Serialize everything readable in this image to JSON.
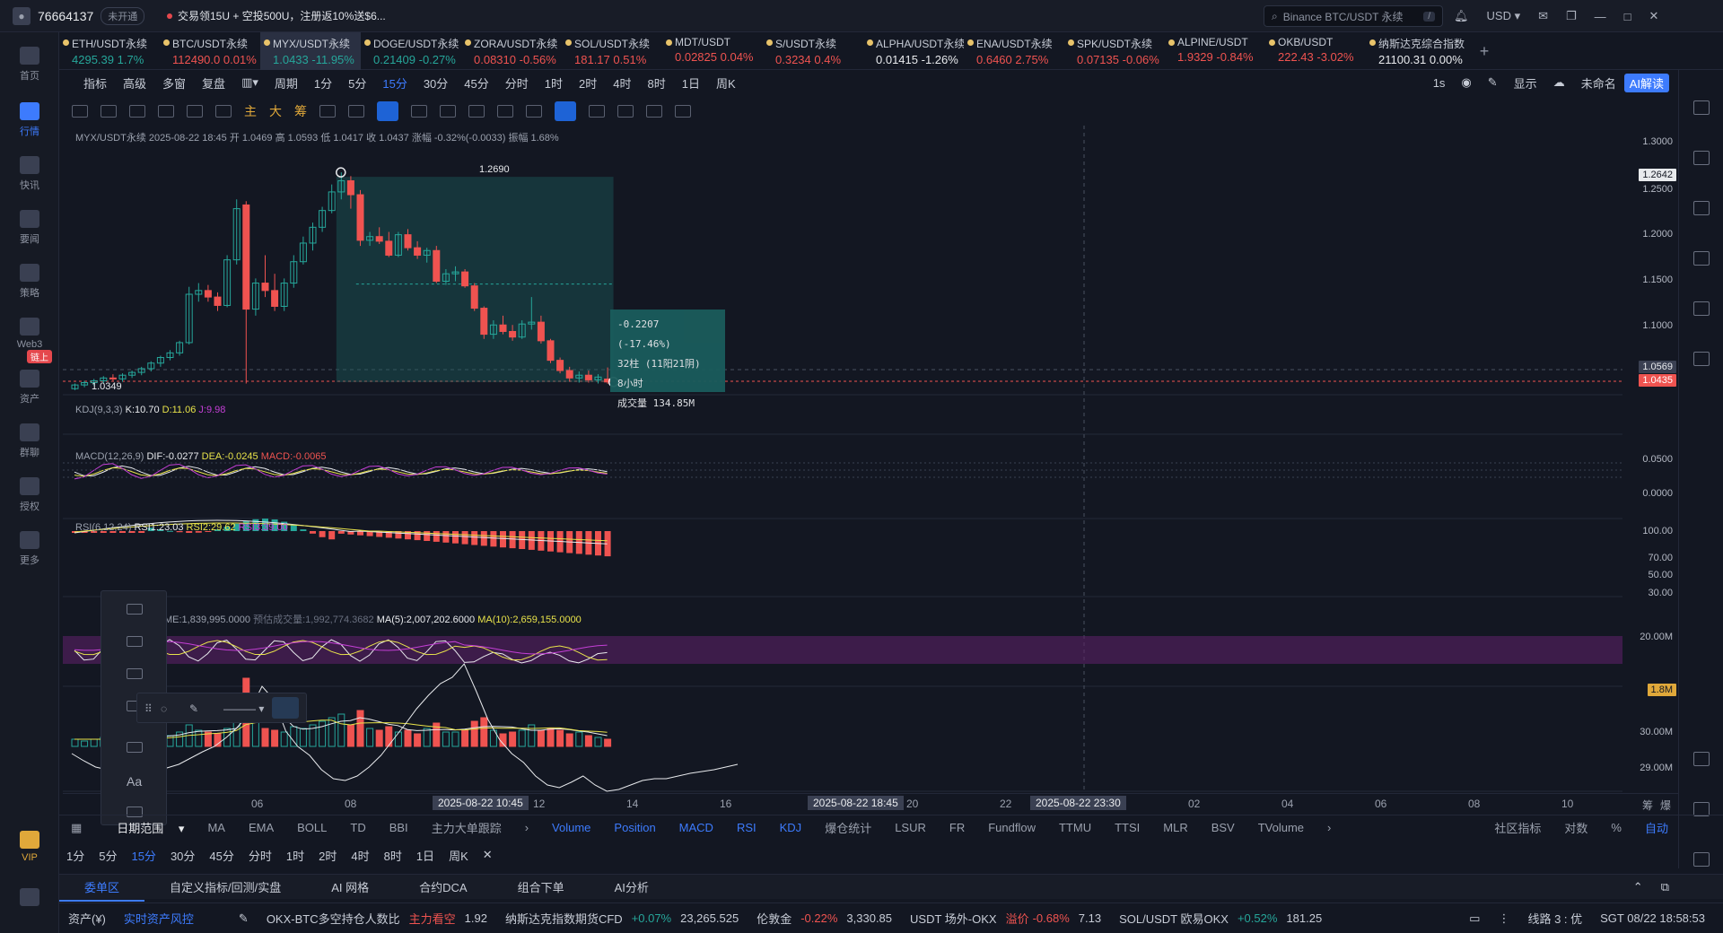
{
  "topbar": {
    "user_id": "76664137",
    "badge": "未开通",
    "promo": "交易领15U + 空投500U，注册返10%送$6...",
    "search_placeholder": "Binance BTC/USDT 永续",
    "search_kbd": "/",
    "currency": "USD"
  },
  "sidebar": {
    "items": [
      {
        "label": "首页"
      },
      {
        "label": "行情"
      },
      {
        "label": "快讯"
      },
      {
        "label": "要闻"
      },
      {
        "label": "策略"
      },
      {
        "label": "Web3"
      },
      {
        "label": "资产"
      },
      {
        "label": "群聊"
      },
      {
        "label": "授权"
      },
      {
        "label": "更多"
      },
      {
        "label": "VIP"
      }
    ],
    "badge_chain": "链上"
  },
  "tickers": [
    {
      "name": "ETH/USDT永续",
      "price": "4295.39",
      "change": "1.7%",
      "dir": "up"
    },
    {
      "name": "BTC/USDT永续",
      "price": "112490.0",
      "change": "0.01%",
      "dir": "dn"
    },
    {
      "name": "MYX/USDT永续",
      "price": "1.0433",
      "change": "-11.95%",
      "dir": "up"
    },
    {
      "name": "DOGE/USDT永续",
      "price": "0.21409",
      "change": "-0.27%",
      "dir": "up"
    },
    {
      "name": "ZORA/USDT永续",
      "price": "0.08310",
      "change": "-0.56%",
      "dir": "dn"
    },
    {
      "name": "SOL/USDT永续",
      "price": "181.17",
      "change": "0.51%",
      "dir": "dn"
    },
    {
      "name": "MDT/USDT",
      "price": "0.02825",
      "change": "0.04%",
      "dir": "dn"
    },
    {
      "name": "S/USDT永续",
      "price": "0.3234",
      "change": "0.4%",
      "dir": "dn"
    },
    {
      "name": "ALPHA/USDT永续",
      "price": "0.01415",
      "change": "-1.26%",
      "dir": "wh"
    },
    {
      "name": "ENA/USDT永续",
      "price": "0.6460",
      "change": "2.75%",
      "dir": "dn"
    },
    {
      "name": "SPK/USDT永续",
      "price": "0.07135",
      "change": "-0.06%",
      "dir": "dn"
    },
    {
      "name": "ALPINE/USDT",
      "price": "1.9329",
      "change": "-0.84%",
      "dir": "dn"
    },
    {
      "name": "OKB/USDT",
      "price": "222.43",
      "change": "-3.02%",
      "dir": "dn"
    },
    {
      "name": "纳斯达克综合指数",
      "price": "21100.31",
      "change": "0.00%",
      "dir": "wh"
    }
  ],
  "toolbar": {
    "items": [
      "指标",
      "高级",
      "多窗",
      "复盘",
      "周期",
      "1分",
      "5分",
      "15分",
      "30分",
      "45分",
      "分时",
      "1时",
      "2时",
      "4时",
      "8时",
      "1日",
      "周K"
    ],
    "selected": "15分",
    "right": [
      "1s",
      "显示",
      "未命名",
      "AI解读"
    ]
  },
  "drawbar": {
    "labels": [
      "主",
      "大",
      "筹"
    ]
  },
  "chart_data": {
    "type": "candlestick",
    "symbol": "MYX/USDT永续",
    "ohlc_line": "2025-08-22 18:45 开 1.0469 高 1.0593 低 1.0417 收 1.0437 涨幅 -0.32%(-0.0033) 振幅 1.68%",
    "y_ticks": [
      "1.3000",
      "1.2500",
      "1.2000",
      "1.1500",
      "1.1000"
    ],
    "price_tags": {
      "high_mark": "1.2642",
      "last_price": "1.0435",
      "crosshair": "1.0569"
    },
    "annotations": {
      "high": "1.2690",
      "low": "1.0349"
    },
    "measure": {
      "change": "-0.2207 (-17.46%)",
      "bars": "32柱 (11阳21阴)",
      "duration": "8小时",
      "volume": "成交量 134.85M"
    },
    "candles": [
      [
        1.0365,
        1.042,
        1.0349,
        1.0405
      ],
      [
        1.0405,
        1.045,
        1.038,
        1.043
      ],
      [
        1.043,
        1.047,
        1.04,
        1.045
      ],
      [
        1.045,
        1.05,
        1.042,
        1.048
      ],
      [
        1.048,
        1.052,
        1.045,
        1.047
      ],
      [
        1.047,
        1.053,
        1.044,
        1.051
      ],
      [
        1.051,
        1.056,
        1.048,
        1.054
      ],
      [
        1.054,
        1.06,
        1.051,
        1.058
      ],
      [
        1.058,
        1.066,
        1.055,
        1.064
      ],
      [
        1.064,
        1.072,
        1.06,
        1.07
      ],
      [
        1.07,
        1.078,
        1.067,
        1.075
      ],
      [
        1.075,
        1.088,
        1.072,
        1.086
      ],
      [
        1.086,
        1.146,
        1.084,
        1.138
      ],
      [
        1.138,
        1.15,
        1.13,
        1.142
      ],
      [
        1.142,
        1.148,
        1.13,
        1.135
      ],
      [
        1.135,
        1.14,
        1.12,
        1.126
      ],
      [
        1.126,
        1.18,
        1.124,
        1.175
      ],
      [
        1.175,
        1.24,
        1.17,
        1.23
      ],
      [
        1.234,
        1.238,
        1.042,
        1.122
      ],
      [
        1.122,
        1.155,
        1.115,
        1.15
      ],
      [
        1.15,
        1.18,
        1.135,
        1.142
      ],
      [
        1.142,
        1.16,
        1.12,
        1.125
      ],
      [
        1.125,
        1.155,
        1.12,
        1.15
      ],
      [
        1.15,
        1.18,
        1.145,
        1.173
      ],
      [
        1.173,
        1.2,
        1.17,
        1.193
      ],
      [
        1.193,
        1.215,
        1.185,
        1.21
      ],
      [
        1.21,
        1.232,
        1.205,
        1.228
      ],
      [
        1.228,
        1.256,
        1.225,
        1.248
      ],
      [
        1.248,
        1.269,
        1.24,
        1.26
      ],
      [
        1.26,
        1.265,
        1.23,
        1.245
      ],
      [
        1.245,
        1.25,
        1.19,
        1.196
      ],
      [
        1.196,
        1.205,
        1.19,
        1.2
      ],
      [
        1.2,
        1.21,
        1.192,
        1.195
      ],
      [
        1.195,
        1.205,
        1.178,
        1.18
      ],
      [
        1.18,
        1.205,
        1.178,
        1.202
      ],
      [
        1.202,
        1.208,
        1.185,
        1.188
      ],
      [
        1.188,
        1.195,
        1.176,
        1.18
      ],
      [
        1.18,
        1.188,
        1.172,
        1.185
      ],
      [
        1.185,
        1.19,
        1.15,
        1.152
      ],
      [
        1.152,
        1.165,
        1.148,
        1.16
      ],
      [
        1.16,
        1.168,
        1.152,
        1.162
      ],
      [
        1.162,
        1.165,
        1.145,
        1.147
      ],
      [
        1.147,
        1.15,
        1.12,
        1.123
      ],
      [
        1.123,
        1.125,
        1.09,
        1.095
      ],
      [
        1.095,
        1.11,
        1.09,
        1.105
      ],
      [
        1.105,
        1.115,
        1.095,
        1.098
      ],
      [
        1.098,
        1.105,
        1.088,
        1.092
      ],
      [
        1.092,
        1.11,
        1.09,
        1.106
      ],
      [
        1.106,
        1.135,
        1.1,
        1.108
      ],
      [
        1.108,
        1.115,
        1.085,
        1.088
      ],
      [
        1.088,
        1.09,
        1.064,
        1.067
      ],
      [
        1.067,
        1.07,
        1.053,
        1.056
      ],
      [
        1.056,
        1.06,
        1.044,
        1.048
      ],
      [
        1.048,
        1.055,
        1.043,
        1.051
      ],
      [
        1.051,
        1.056,
        1.043,
        1.046
      ],
      [
        1.046,
        1.052,
        1.042,
        1.049
      ],
      [
        1.0469,
        1.0593,
        1.0417,
        1.0437
      ]
    ]
  },
  "indicators": {
    "kdj": {
      "label": "KDJ(9,3,3)",
      "k": "K:10.70",
      "d": "D:11.06",
      "j": "J:9.98"
    },
    "macd": {
      "label": "MACD(12,26,9)",
      "dif": "DIF:-0.0277",
      "dea": "DEA:-0.0245",
      "macd": "MACD:-0.0065",
      "ticks": [
        "0.0500",
        "0.0000"
      ]
    },
    "rsi": {
      "label": "RSI(6,12,24)",
      "rsi1": "RSI1:23.03",
      "rsi2": "RSI2:29.62",
      "rsi3": "RSI3:39.00",
      "ticks": [
        "100.00",
        "70.00",
        "50.00",
        "30.00"
      ]
    },
    "vol": {
      "label": "ME:1,839,995.0000",
      "est": "预估成交量:1,992,774.3682",
      "ma5": "MA(5):2,007,202.6000",
      "ma10": "MA(10):2,659,155.0000",
      "ticks": [
        "20.00M",
        "1.8M"
      ]
    },
    "pos": {
      "ticks": [
        "30.00M",
        "29.00M"
      ]
    }
  },
  "timeaxis": {
    "labels": [
      "06",
      "08",
      "12",
      "14",
      "16",
      "20",
      "22",
      "02",
      "04",
      "06",
      "08",
      "10"
    ],
    "highlights": [
      "2025-08-22 10:45",
      "2025-08-22 18:45",
      "2025-08-22 23:30"
    ],
    "right": [
      "筹",
      "爆"
    ]
  },
  "indicator_bar": {
    "range_label": "日期范围",
    "main": [
      "MA",
      "EMA",
      "BOLL",
      "TD",
      "BBI",
      "主力大单跟踪"
    ],
    "sub": [
      "Volume",
      "Position",
      "MACD",
      "RSI",
      "KDJ",
      "爆仓统计",
      "LSUR",
      "FR",
      "Fundflow",
      "TTMU",
      "TTSI",
      "MLR",
      "BSV",
      "TVolume"
    ],
    "sub_active": [
      "Volume",
      "Position",
      "MACD",
      "RSI",
      "KDJ"
    ],
    "right": [
      "社区指标",
      "对数",
      "%",
      "自动"
    ]
  },
  "tf_bar": {
    "items": [
      "1分",
      "5分",
      "15分",
      "30分",
      "45分",
      "分时",
      "1时",
      "2时",
      "4时",
      "8时",
      "1日",
      "周K"
    ],
    "selected": "15分"
  },
  "bottom_tabs": {
    "items": [
      "委单区",
      "自定义指标/回测/实盘",
      "AI 网格",
      "合约DCA",
      "组合下单",
      "AI分析"
    ]
  },
  "statusbar": {
    "asset": "资产(¥)",
    "risk": "实时资产风控",
    "i1_name": "OKX-BTC多空持仓人数比",
    "i1_tag": "主力看空",
    "i1_val": "1.92",
    "i2_name": "纳斯达克指数期货CFD",
    "i2_chg": "+0.07%",
    "i2_val": "23,265.525",
    "i3_name": "伦敦金",
    "i3_chg": "-0.22%",
    "i3_val": "3,330.85",
    "i4_name": "USDT 场外-OKX",
    "i4_tag": "溢价",
    "i4_chg": "-0.68%",
    "i4_val": "7.13",
    "i5_name": "SOL/USDT 欧易OKX",
    "i5_chg": "+0.52%",
    "i5_val": "181.25",
    "line": "线路 3 : 优",
    "time": "SGT 08/22 18:58:53"
  }
}
